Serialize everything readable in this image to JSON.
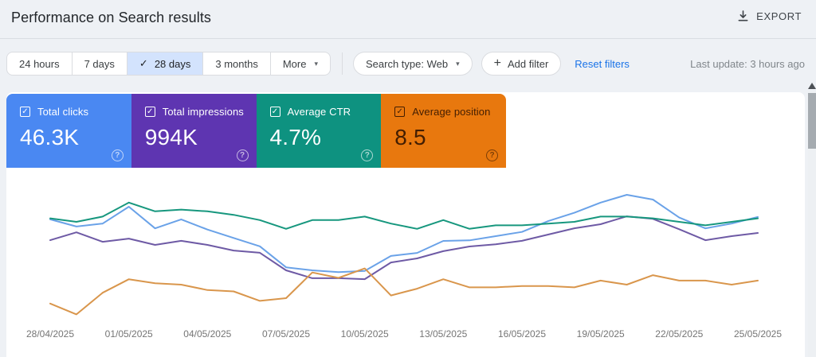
{
  "header": {
    "title": "Performance on Search results",
    "export_label": "EXPORT"
  },
  "icons": {
    "check": "✓",
    "caret": "▾",
    "plus": "+",
    "question": "?"
  },
  "filters": {
    "date_ranges": [
      {
        "label": "24 hours",
        "selected": false
      },
      {
        "label": "7 days",
        "selected": false
      },
      {
        "label": "28 days",
        "selected": true
      },
      {
        "label": "3 months",
        "selected": false
      },
      {
        "label": "More",
        "selected": false,
        "has_menu": true
      }
    ],
    "search_type": "Search type: Web",
    "add_filter_label": "Add filter",
    "reset_label": "Reset filters",
    "last_update": "Last update: 3 hours ago"
  },
  "metrics": [
    {
      "label": "Total clicks",
      "value": "46.3K",
      "color": "#4a88f2",
      "text_color": "#ffffff",
      "checked": true
    },
    {
      "label": "Total impressions",
      "value": "994K",
      "color": "#5e35b1",
      "text_color": "#ffffff",
      "checked": true
    },
    {
      "label": "Average CTR",
      "value": "4.7%",
      "color": "#0e9280",
      "text_color": "#ffffff",
      "checked": true
    },
    {
      "label": "Average position",
      "value": "8.5",
      "color": "#e8780e",
      "text_color": "#431e02",
      "checked": true
    }
  ],
  "chart_data": {
    "type": "line",
    "grid": false,
    "legend_position": "none",
    "x": [
      "28/04/2025",
      "29/04/2025",
      "30/04/2025",
      "01/05/2025",
      "02/05/2025",
      "03/05/2025",
      "04/05/2025",
      "05/05/2025",
      "06/05/2025",
      "07/05/2025",
      "08/05/2025",
      "09/05/2025",
      "10/05/2025",
      "11/05/2025",
      "12/05/2025",
      "13/05/2025",
      "14/05/2025",
      "15/05/2025",
      "16/05/2025",
      "17/05/2025",
      "18/05/2025",
      "19/05/2025",
      "20/05/2025",
      "21/05/2025",
      "22/05/2025",
      "23/05/2025",
      "24/05/2025",
      "25/05/2025"
    ],
    "tick_labels": [
      "28/04/2025",
      "01/05/2025",
      "04/05/2025",
      "07/05/2025",
      "10/05/2025",
      "13/05/2025",
      "16/05/2025",
      "19/05/2025",
      "22/05/2025",
      "25/05/2025"
    ],
    "series": [
      {
        "name": "clicks",
        "color": "#6aa2e8",
        "ylim": [
          344,
          2532
        ],
        "inverted": false,
        "values": [
          1990,
          1870,
          1920,
          2200,
          1840,
          1990,
          1820,
          1680,
          1540,
          1190,
          1140,
          1110,
          1130,
          1380,
          1430,
          1630,
          1640,
          1710,
          1780,
          1960,
          2100,
          2270,
          2400,
          2320,
          2020,
          1840,
          1920,
          2030
        ]
      },
      {
        "name": "impressions",
        "color": "#6e5aa5",
        "ylim": [
          15600,
          57400
        ],
        "inverted": false,
        "values": [
          40400,
          42900,
          39900,
          40900,
          38900,
          40200,
          38900,
          37100,
          36400,
          30800,
          28300,
          28300,
          28000,
          33300,
          34600,
          36900,
          38400,
          39100,
          40200,
          42200,
          44200,
          45500,
          48000,
          47200,
          43900,
          40400,
          41700,
          42700
        ]
      },
      {
        "name": "ctr",
        "color": "#17977e",
        "unit": "%",
        "ylim": [
          -1.1,
          6.4
        ],
        "inverted": false,
        "values": [
          4.6,
          4.4,
          4.7,
          5.5,
          5.0,
          5.1,
          5.0,
          4.8,
          4.5,
          4.0,
          4.5,
          4.5,
          4.7,
          4.3,
          4.0,
          4.5,
          4.0,
          4.2,
          4.2,
          4.3,
          4.4,
          4.7,
          4.7,
          4.6,
          4.4,
          4.2,
          4.4,
          4.6
        ]
      },
      {
        "name": "position",
        "color": "#d9964c",
        "ylim": [
          0.97,
          10.67
        ],
        "inverted": true,
        "values": [
          9.6,
          10.4,
          8.8,
          7.8,
          8.1,
          8.2,
          8.6,
          8.7,
          9.4,
          9.2,
          7.3,
          7.7,
          7.0,
          9.0,
          8.5,
          7.8,
          8.4,
          8.4,
          8.3,
          8.3,
          8.4,
          7.9,
          8.2,
          7.5,
          7.9,
          7.9,
          8.2,
          7.9
        ]
      }
    ]
  }
}
